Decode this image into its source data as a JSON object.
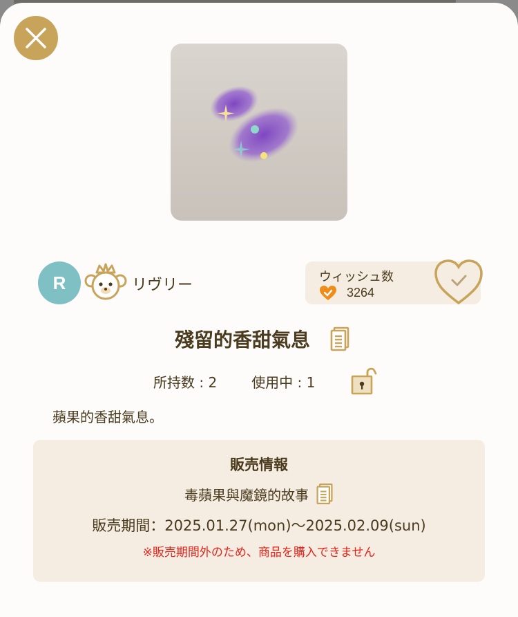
{
  "item": {
    "title": "殘留的香甜氣息",
    "description": "蘋果的香甜氣息。"
  },
  "creator": {
    "avatar_letter": "R",
    "name": "リヴリー"
  },
  "wish": {
    "label": "ウィッシュ数",
    "count": "3264"
  },
  "stats": {
    "held": "所持数 : 2",
    "in_use": "使用中 : 1"
  },
  "sale": {
    "heading": "販売情報",
    "story": "毒蘋果與魔鏡的故事",
    "period": "販売期間：2025.01.27(mon)〜2025.02.09(sun)",
    "warning": "※販売期間外のため、商品を購入できません"
  },
  "icons": {
    "close": "close-icon",
    "copy": "document-copy-icon",
    "lock": "unlock-icon",
    "wish_heart": "heart-check-icon",
    "badge": "teddy-bear-badge-icon"
  },
  "colors": {
    "gold": "#c8a35a",
    "panel": "#f5ede1",
    "text": "#4a3a1e",
    "warning": "#e8231b",
    "avatar": "#7fc0c4",
    "heart_orange": "#f08c1a"
  }
}
